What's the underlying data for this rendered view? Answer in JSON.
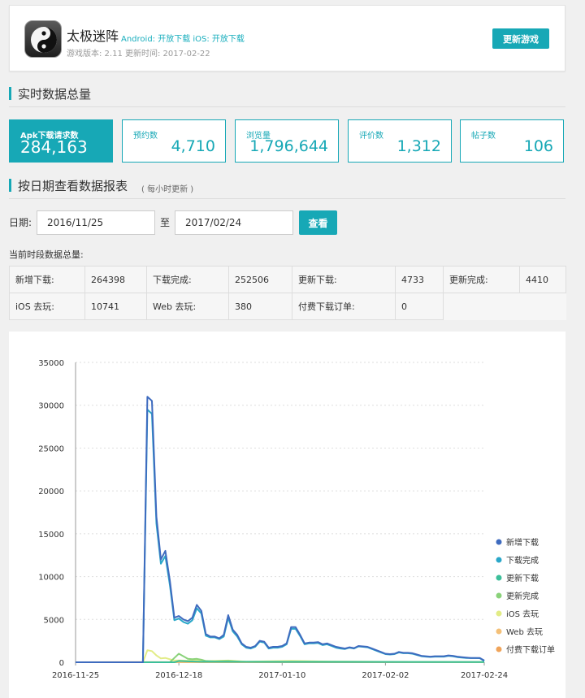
{
  "game": {
    "name": "太极迷阵",
    "platforms": "Android: 开放下载  iOS: 开放下载",
    "meta": "游戏版本: 2.11 更新时间: 2017-02-22",
    "update_button": "更新游戏"
  },
  "realtime": {
    "title": "实时数据总量",
    "stats": [
      {
        "label": "Apk下载请求数",
        "value": "284,163"
      },
      {
        "label": "预约数",
        "value": "4,710"
      },
      {
        "label": "浏览量",
        "value": "1,796,644"
      },
      {
        "label": "评价数",
        "value": "1,312"
      },
      {
        "label": "帖子数",
        "value": "106"
      }
    ]
  },
  "report": {
    "title": "按日期查看数据报表",
    "note": "( 每小时更新 )",
    "date_label": "日期:",
    "start_date": "2016/11/25",
    "to_label": "至",
    "end_date": "2017/02/24",
    "query_button": "查看",
    "period_title": "当前时段数据总量:",
    "rows": [
      [
        {
          "k": "新增下载:",
          "v": "264398"
        },
        {
          "k": "下载完成:",
          "v": "252506"
        },
        {
          "k": "更新下载:",
          "v": "4733"
        },
        {
          "k": "更新完成:",
          "v": "4410"
        }
      ],
      [
        {
          "k": "iOS 去玩:",
          "v": "10741"
        },
        {
          "k": "Web 去玩:",
          "v": "380"
        },
        {
          "k": "付费下载订单:",
          "v": "0"
        }
      ]
    ]
  },
  "chart_data": {
    "type": "line",
    "title": "",
    "xlabel": "",
    "ylabel": "",
    "x_ticks": [
      "2016-11-25",
      "2016-12-18",
      "2017-01-10",
      "2017-02-02",
      "2017-02-24"
    ],
    "ylim": [
      0,
      35000
    ],
    "yticks": [
      0,
      5000,
      10000,
      15000,
      20000,
      25000,
      30000,
      35000
    ],
    "grid": true,
    "legend_position": "right",
    "series_colors": [
      "#3e6bbf",
      "#2aa7c9",
      "#3cbf9a",
      "#8ad27a",
      "#e2ec86",
      "#f4c078",
      "#f0a45a"
    ],
    "series": [
      {
        "name": "新增下载",
        "points": [
          [
            "2016-11-25",
            0
          ],
          [
            "2016-12-10",
            0
          ],
          [
            "2016-12-11",
            31000
          ],
          [
            "2016-12-12",
            30500
          ],
          [
            "2016-12-13",
            17000
          ],
          [
            "2016-12-14",
            12000
          ],
          [
            "2016-12-15",
            13000
          ],
          [
            "2016-12-16",
            9500
          ],
          [
            "2016-12-17",
            5200
          ],
          [
            "2016-12-18",
            5400
          ],
          [
            "2016-12-19",
            5000
          ],
          [
            "2016-12-20",
            4800
          ],
          [
            "2016-12-21",
            5200
          ],
          [
            "2016-12-22",
            6700
          ],
          [
            "2016-12-23",
            6000
          ],
          [
            "2016-12-24",
            3300
          ],
          [
            "2016-12-25",
            3000
          ],
          [
            "2016-12-26",
            3000
          ],
          [
            "2016-12-27",
            2800
          ],
          [
            "2016-12-28",
            3200
          ],
          [
            "2016-12-29",
            5500
          ],
          [
            "2016-12-30",
            3800
          ],
          [
            "2016-12-31",
            3200
          ],
          [
            "2017-01-01",
            2200
          ],
          [
            "2017-01-02",
            1800
          ],
          [
            "2017-01-03",
            1700
          ],
          [
            "2017-01-04",
            1900
          ],
          [
            "2017-01-05",
            2500
          ],
          [
            "2017-01-06",
            2400
          ],
          [
            "2017-01-07",
            1700
          ],
          [
            "2017-01-08",
            1800
          ],
          [
            "2017-01-09",
            1800
          ],
          [
            "2017-01-10",
            1900
          ],
          [
            "2017-01-11",
            2200
          ],
          [
            "2017-01-12",
            4100
          ],
          [
            "2017-01-13",
            4100
          ],
          [
            "2017-01-14",
            3200
          ],
          [
            "2017-01-15",
            2200
          ],
          [
            "2017-01-16",
            2300
          ],
          [
            "2017-01-17",
            2300
          ],
          [
            "2017-01-18",
            2350
          ],
          [
            "2017-01-19",
            2100
          ],
          [
            "2017-01-20",
            2200
          ],
          [
            "2017-01-21",
            2000
          ],
          [
            "2017-01-22",
            1800
          ],
          [
            "2017-01-23",
            1700
          ],
          [
            "2017-01-24",
            1600
          ],
          [
            "2017-01-25",
            1750
          ],
          [
            "2017-01-26",
            1650
          ],
          [
            "2017-01-27",
            1900
          ],
          [
            "2017-01-28",
            1850
          ],
          [
            "2017-01-29",
            1800
          ],
          [
            "2017-01-30",
            1600
          ],
          [
            "2017-01-31",
            1400
          ],
          [
            "2017-02-01",
            1200
          ],
          [
            "2017-02-02",
            1000
          ],
          [
            "2017-02-03",
            950
          ],
          [
            "2017-02-04",
            1000
          ],
          [
            "2017-02-05",
            1200
          ],
          [
            "2017-02-06",
            1100
          ],
          [
            "2017-02-07",
            1100
          ],
          [
            "2017-02-08",
            1050
          ],
          [
            "2017-02-09",
            900
          ],
          [
            "2017-02-10",
            750
          ],
          [
            "2017-02-11",
            700
          ],
          [
            "2017-02-12",
            650
          ],
          [
            "2017-02-13",
            700
          ],
          [
            "2017-02-14",
            700
          ],
          [
            "2017-02-15",
            700
          ],
          [
            "2017-02-16",
            800
          ],
          [
            "2017-02-17",
            750
          ],
          [
            "2017-02-18",
            650
          ],
          [
            "2017-02-19",
            600
          ],
          [
            "2017-02-20",
            550
          ],
          [
            "2017-02-21",
            500
          ],
          [
            "2017-02-22",
            500
          ],
          [
            "2017-02-23",
            500
          ],
          [
            "2017-02-24",
            200
          ]
        ]
      },
      {
        "name": "下载完成",
        "points": [
          [
            "2016-11-25",
            0
          ],
          [
            "2016-12-10",
            0
          ],
          [
            "2016-12-11",
            29500
          ],
          [
            "2016-12-12",
            29000
          ],
          [
            "2016-12-13",
            16200
          ],
          [
            "2016-12-14",
            11500
          ],
          [
            "2016-12-15",
            12400
          ],
          [
            "2016-12-16",
            9000
          ],
          [
            "2016-12-17",
            4900
          ],
          [
            "2016-12-18",
            5100
          ],
          [
            "2016-12-19",
            4700
          ],
          [
            "2016-12-20",
            4500
          ],
          [
            "2016-12-21",
            4900
          ],
          [
            "2016-12-22",
            6300
          ],
          [
            "2016-12-23",
            5700
          ],
          [
            "2016-12-24",
            3100
          ],
          [
            "2016-12-25",
            2900
          ],
          [
            "2016-12-26",
            2900
          ],
          [
            "2016-12-27",
            2700
          ],
          [
            "2016-12-28",
            3000
          ],
          [
            "2016-12-29",
            5200
          ],
          [
            "2016-12-30",
            3600
          ],
          [
            "2016-12-31",
            3000
          ],
          [
            "2017-01-01",
            2100
          ],
          [
            "2017-01-02",
            1700
          ],
          [
            "2017-01-03",
            1600
          ],
          [
            "2017-01-04",
            1800
          ],
          [
            "2017-01-05",
            2400
          ],
          [
            "2017-01-06",
            2300
          ],
          [
            "2017-01-07",
            1600
          ],
          [
            "2017-01-08",
            1700
          ],
          [
            "2017-01-09",
            1700
          ],
          [
            "2017-01-10",
            1800
          ],
          [
            "2017-01-11",
            2100
          ],
          [
            "2017-01-12",
            3900
          ],
          [
            "2017-01-13",
            3900
          ],
          [
            "2017-01-14",
            3050
          ],
          [
            "2017-01-15",
            2100
          ],
          [
            "2017-01-16",
            2200
          ],
          [
            "2017-01-17",
            2200
          ],
          [
            "2017-01-18",
            2250
          ],
          [
            "2017-01-19",
            2000
          ],
          [
            "2017-01-20",
            2100
          ],
          [
            "2017-01-21",
            1900
          ],
          [
            "2017-01-22",
            1700
          ],
          [
            "2017-01-23",
            1600
          ],
          [
            "2017-01-24",
            1550
          ],
          [
            "2017-01-25",
            1700
          ],
          [
            "2017-01-26",
            1600
          ],
          [
            "2017-01-27",
            1850
          ],
          [
            "2017-01-28",
            1800
          ],
          [
            "2017-01-29",
            1750
          ],
          [
            "2017-01-30",
            1550
          ],
          [
            "2017-01-31",
            1350
          ],
          [
            "2017-02-01",
            1150
          ],
          [
            "2017-02-02",
            950
          ],
          [
            "2017-02-03",
            900
          ],
          [
            "2017-02-04",
            950
          ],
          [
            "2017-02-05",
            1150
          ],
          [
            "2017-02-06",
            1050
          ],
          [
            "2017-02-07",
            1050
          ],
          [
            "2017-02-08",
            1000
          ],
          [
            "2017-02-09",
            850
          ],
          [
            "2017-02-10",
            700
          ],
          [
            "2017-02-11",
            650
          ],
          [
            "2017-02-12",
            620
          ],
          [
            "2017-02-13",
            650
          ],
          [
            "2017-02-14",
            650
          ],
          [
            "2017-02-15",
            650
          ],
          [
            "2017-02-16",
            750
          ],
          [
            "2017-02-17",
            700
          ],
          [
            "2017-02-18",
            600
          ],
          [
            "2017-02-19",
            550
          ],
          [
            "2017-02-20",
            500
          ],
          [
            "2017-02-21",
            480
          ],
          [
            "2017-02-22",
            480
          ],
          [
            "2017-02-23",
            470
          ],
          [
            "2017-02-24",
            150
          ]
        ]
      },
      {
        "name": "更新下载",
        "points": [
          [
            "2016-11-25",
            0
          ],
          [
            "2016-12-17",
            0
          ],
          [
            "2016-12-18",
            150
          ],
          [
            "2016-12-20",
            100
          ],
          [
            "2016-12-23",
            60
          ],
          [
            "2017-01-10",
            40
          ],
          [
            "2017-02-24",
            20
          ]
        ]
      },
      {
        "name": "更新完成",
        "points": [
          [
            "2016-11-25",
            0
          ],
          [
            "2016-12-16",
            0
          ],
          [
            "2016-12-17",
            500
          ],
          [
            "2016-12-18",
            1000
          ],
          [
            "2016-12-19",
            700
          ],
          [
            "2016-12-20",
            400
          ],
          [
            "2016-12-21",
            350
          ],
          [
            "2016-12-22",
            400
          ],
          [
            "2016-12-23",
            300
          ],
          [
            "2016-12-24",
            150
          ],
          [
            "2016-12-26",
            100
          ],
          [
            "2016-12-29",
            150
          ],
          [
            "2017-01-01",
            60
          ],
          [
            "2017-01-12",
            80
          ],
          [
            "2017-02-24",
            30
          ]
        ]
      },
      {
        "name": "iOS 去玩",
        "points": [
          [
            "2016-11-25",
            0
          ],
          [
            "2016-12-10",
            0
          ],
          [
            "2016-12-11",
            1400
          ],
          [
            "2016-12-12",
            1300
          ],
          [
            "2016-12-13",
            800
          ],
          [
            "2016-12-14",
            450
          ],
          [
            "2016-12-15",
            500
          ],
          [
            "2016-12-16",
            350
          ],
          [
            "2016-12-17",
            200
          ],
          [
            "2016-12-18",
            220
          ],
          [
            "2016-12-20",
            180
          ],
          [
            "2016-12-22",
            250
          ],
          [
            "2016-12-24",
            120
          ],
          [
            "2016-12-29",
            200
          ],
          [
            "2017-01-02",
            80
          ],
          [
            "2017-01-12",
            150
          ],
          [
            "2017-01-20",
            90
          ],
          [
            "2017-02-02",
            50
          ],
          [
            "2017-02-24",
            20
          ]
        ]
      },
      {
        "name": "Web 去玩",
        "points": [
          [
            "2016-11-25",
            0
          ],
          [
            "2016-12-11",
            30
          ],
          [
            "2016-12-18",
            10
          ],
          [
            "2017-02-24",
            5
          ]
        ]
      },
      {
        "name": "付费下载订单",
        "points": [
          [
            "2016-11-25",
            0
          ],
          [
            "2017-02-24",
            0
          ]
        ]
      }
    ]
  }
}
